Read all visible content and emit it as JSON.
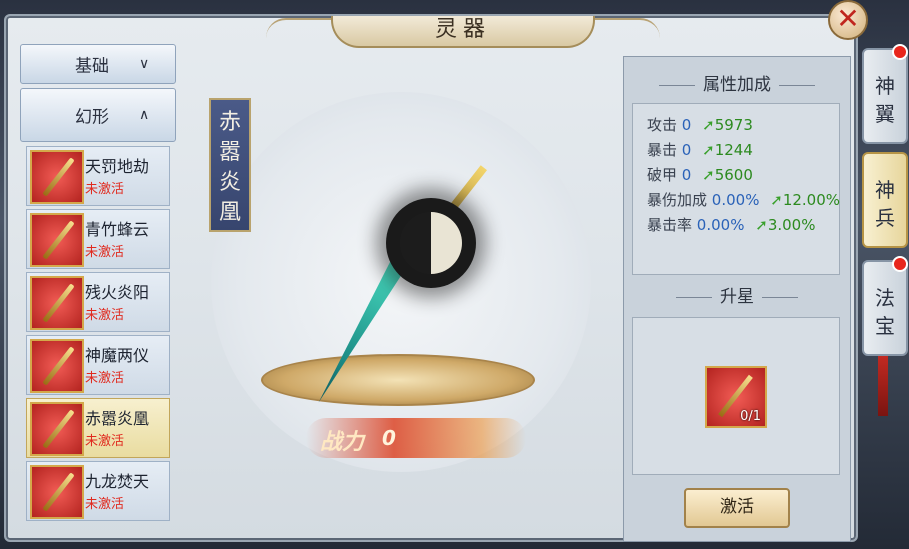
{
  "window": {
    "title": "灵器"
  },
  "close_button": {
    "glyph": "✕"
  },
  "categories": {
    "basic": {
      "label": "基础",
      "chevron": "∨"
    },
    "skin": {
      "label": "幻形",
      "chevron": "∧"
    }
  },
  "items": [
    {
      "name": "天罚地劫",
      "status": "未激活"
    },
    {
      "name": "青竹蜂云",
      "status": "未激活"
    },
    {
      "name": "残火炎阳",
      "status": "未激活"
    },
    {
      "name": "神魔两仪",
      "status": "未激活"
    },
    {
      "name": "赤嚣炎凰",
      "status": "未激活"
    },
    {
      "name": "九龙焚天",
      "status": "未激活"
    }
  ],
  "selected_item_index": 4,
  "stage": {
    "banner_chars": [
      "赤",
      "嚣",
      "炎",
      "凰"
    ],
    "power_label": "战力",
    "power_value": "0"
  },
  "attributes": {
    "header": "属性加成",
    "rows": [
      {
        "label": "攻击",
        "base": "0",
        "add": "5973"
      },
      {
        "label": "暴击",
        "base": "0",
        "add": "1244"
      },
      {
        "label": "破甲",
        "base": "0",
        "add": "5600"
      },
      {
        "label": "暴伤加成",
        "base": "0.00%",
        "add": "12.00%"
      },
      {
        "label": "暴击率",
        "base": "0.00%",
        "add": "3.00%"
      }
    ]
  },
  "upgrade": {
    "header": "升星",
    "material_count": "0/1",
    "activate_label": "激活"
  },
  "side_tabs": [
    {
      "chars": [
        "神",
        "翼"
      ],
      "active": false,
      "dot": true
    },
    {
      "chars": [
        "神",
        "兵"
      ],
      "active": true,
      "dot": false
    },
    {
      "chars": [
        "法",
        "宝"
      ],
      "active": false,
      "dot": true
    }
  ],
  "colors": {
    "attr_base": "#2a62b8",
    "attr_add": "#2c8a1f",
    "status_inactive": "#e02a1f"
  }
}
